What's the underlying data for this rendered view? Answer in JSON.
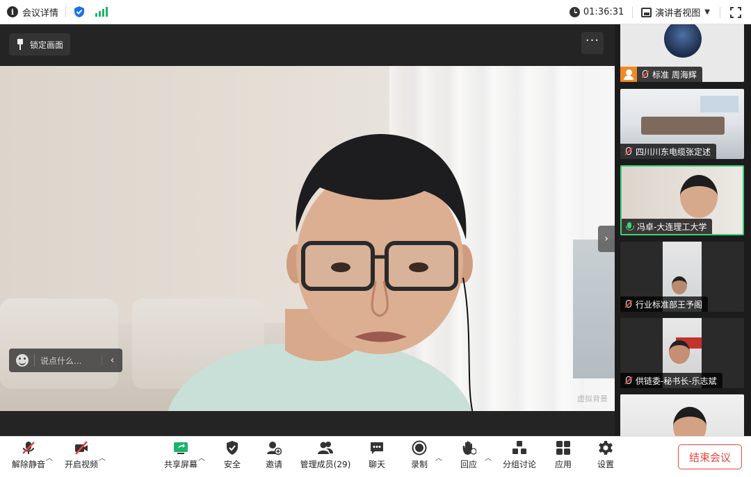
{
  "topbar": {
    "title": "会议详情",
    "timer": "01:36:31",
    "view_mode": "演讲者视图"
  },
  "main": {
    "lock_button": "锁定画面",
    "more_button": "···",
    "chat_placeholder": "说点什么...",
    "virtual_background_label": "虚拟背景"
  },
  "gallery": {
    "tiles": [
      {
        "label": "标准 周海辉",
        "mic": "muted",
        "host": true
      },
      {
        "label": "四川川东电缆张定述",
        "mic": "muted"
      },
      {
        "label": "冯卓-大连理工大学",
        "mic": "active",
        "active": true
      },
      {
        "label": "行业标准部王予阁",
        "mic": "muted"
      },
      {
        "label": "供链委-秘书长-乐志斌",
        "mic": "muted"
      },
      {
        "label": "",
        "mic": ""
      }
    ]
  },
  "toolbar": {
    "unmute": "解除静音",
    "start_video": "开启视频",
    "share_screen": "共享屏幕",
    "security": "安全",
    "invite": "邀请",
    "manage_members": "管理成员(29)",
    "chat": "聊天",
    "record": "录制",
    "react": "回应",
    "breakout": "分组讨论",
    "apps": "应用",
    "settings": "设置",
    "end_meeting": "结束会议"
  },
  "colors": {
    "accent_green": "#3fd17a",
    "end_red": "#e8453c",
    "shield_blue": "#1a73e8",
    "host_orange": "#f08a24"
  }
}
